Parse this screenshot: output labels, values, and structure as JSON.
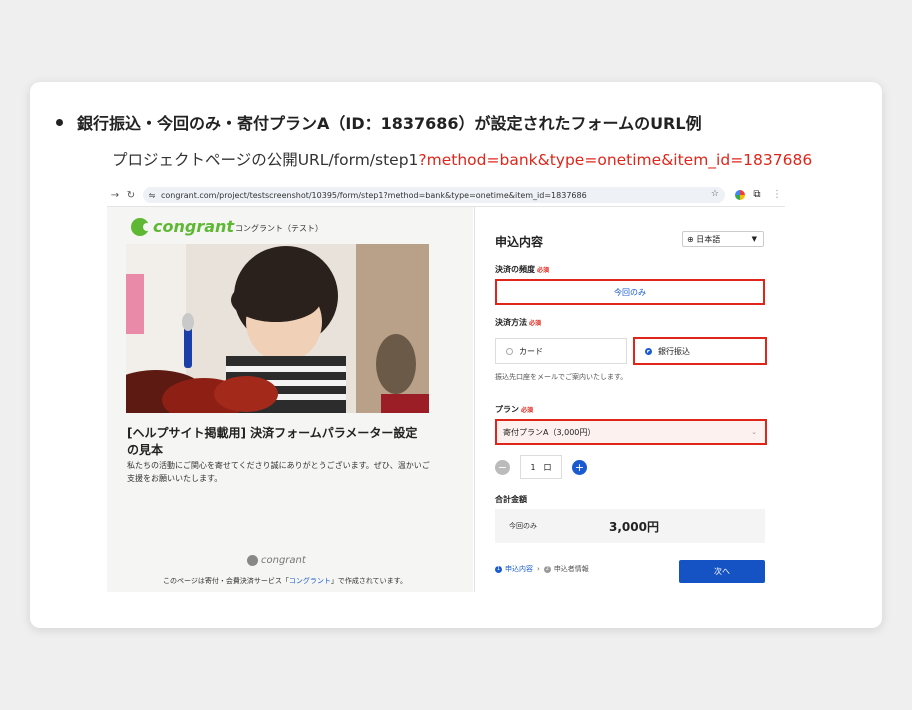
{
  "heading": "銀行振込・今回のみ・寄付プランA（ID：1837686）が設定されたフォームのURL例",
  "url_example": {
    "prefix": "プロジェクトページの公開URL/form/step1",
    "query": "?method=bank&type=onetime&item_id=1837686"
  },
  "browser": {
    "address": "congrant.com/project/testscreenshot/10395/form/step1?method=bank&type=onetime&item_id=1837686"
  },
  "left_panel": {
    "logo_text": "congrant",
    "org_name": "コングラント（テスト）",
    "page_title": "[ヘルプサイト掲載用] 決済フォームパラメーター設定の見本",
    "description": "私たちの活動にご関心を寄せてくださり誠にありがとうございます。ぜひ、温かいご支援をお願いいたします。",
    "footer_logo": "congrant",
    "footer_note_pre": "このページは寄付・会費決済サービス「",
    "footer_note_link": "コングラント",
    "footer_note_post": "」で作成されています。"
  },
  "form": {
    "title": "申込内容",
    "language": "日本語",
    "frequency_label": "決済の頻度",
    "required": "必須",
    "frequency_value": "今回のみ",
    "method_label": "決済方法",
    "method_card": "カード",
    "method_bank": "銀行振込",
    "method_hint": "振込先口座をメールでご案内いたします。",
    "plan_label": "プラン",
    "plan_value": "寄付プランA（3,000円）",
    "quantity": "1",
    "quantity_unit": "口",
    "total_label": "合計金額",
    "total_row_label": "今回のみ",
    "total_value": "3,000円",
    "step1": "申込内容",
    "step2": "申込者情報",
    "next_button": "次へ"
  }
}
